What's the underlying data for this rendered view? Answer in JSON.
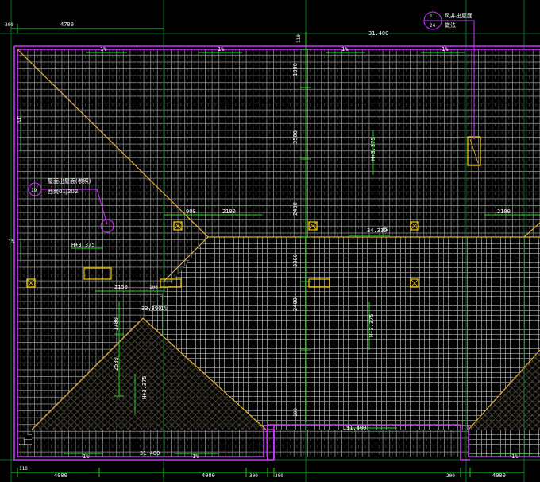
{
  "drawing": {
    "colors": {
      "background": "#000000",
      "tile_grid": "#8a8a8a",
      "outline": "#cc33ff",
      "dimension": "#22dd22",
      "hip_line": "#e0b040",
      "fixture": "#ffcc00",
      "text": "#ffffff"
    },
    "dimensions": {
      "top_4700": "4700",
      "top_300": "300",
      "top_110": "110",
      "vert_1800": "1800",
      "vert_3500": "3500",
      "vert_2400": "2400",
      "vert_3300": "3300",
      "vert_2400b": "2400",
      "vert_100": "100",
      "mid_900": "900",
      "mid_2100": "2100",
      "mid_2100b": "2100",
      "mid_2150": "2150",
      "mid_100": "100",
      "left_1700": "1700",
      "left_2500": "2500",
      "bottom_4000a": "4000",
      "bottom_4000b": "4000",
      "bottom_300a": "300",
      "bottom_300b": "300",
      "bottom_200": "200",
      "bottom_4000c": "4000",
      "bottom_110": "110"
    },
    "slopes": {
      "top_1": "1%",
      "top_2": "1%",
      "top_3": "1%",
      "top_4": "1%",
      "left_1": "1%",
      "left_2": "1%",
      "bottom_1": "1%",
      "bottom_2": "1%",
      "bottom_3": "1%",
      "inner_1": "1%",
      "inner_2": "1%",
      "mid_1": "1%"
    },
    "elevations": {
      "e1": "31.400",
      "e2": "34.310",
      "e3": "33.390",
      "e4": "31.400",
      "e5": "31.400",
      "e6": "H+3.375",
      "e7": "H+3.375",
      "e8": "H+3.375",
      "e9": "H+3.375"
    },
    "callouts": {
      "top_right_line1": "风井出屋面",
      "top_right_line2": "做法",
      "top_right_num1": "11",
      "top_right_num2": "24",
      "left_line1": "屋面出屋面(参照)",
      "left_line2": "西南01J202",
      "left_num": "19"
    }
  }
}
